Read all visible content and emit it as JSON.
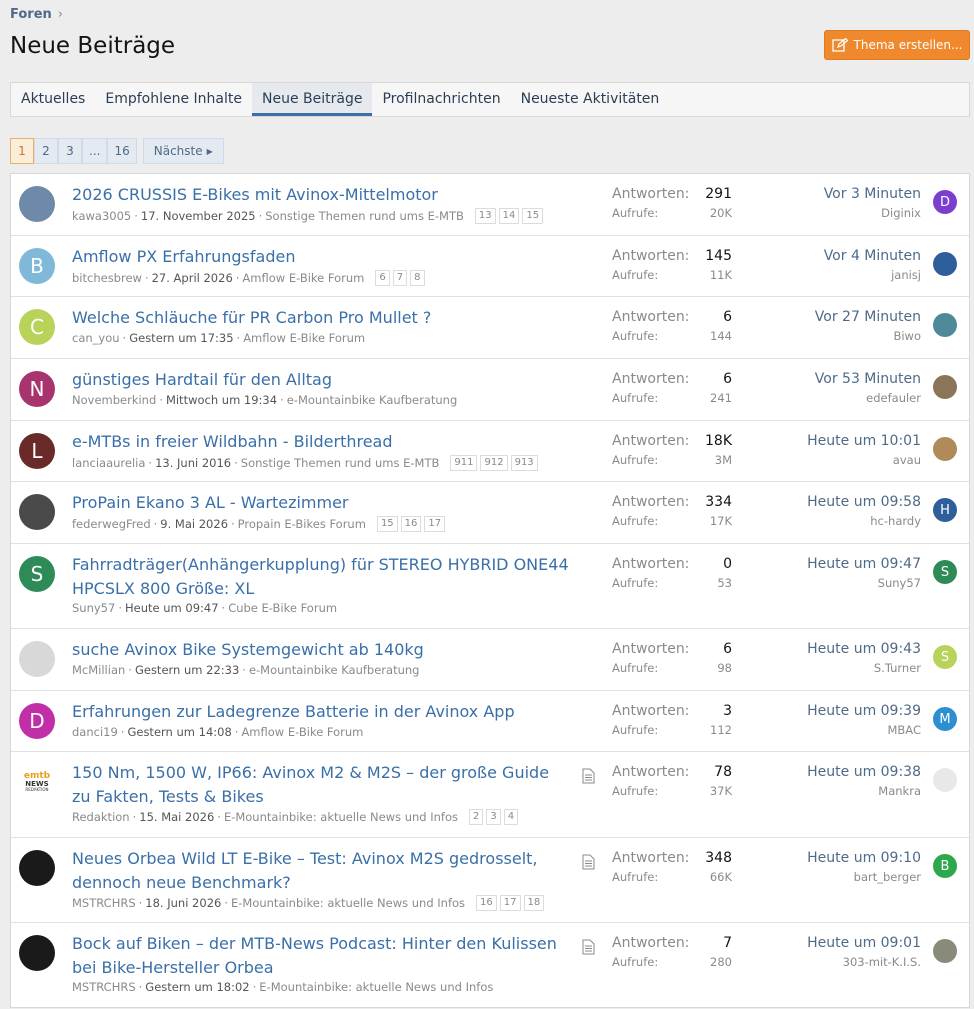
{
  "breadcrumb": {
    "label": "Foren"
  },
  "page_title": "Neue Beiträge",
  "create_button": "Thema erstellen...",
  "tabs": [
    "Aktuelles",
    "Empfohlene Inhalte",
    "Neue Beiträge",
    "Profilnachrichten",
    "Neueste Aktivitäten"
  ],
  "pagination": {
    "pages": [
      "1",
      "2",
      "3",
      "...",
      "16"
    ],
    "next": "Nächste"
  },
  "labels": {
    "replies": "Antworten:",
    "views": "Aufrufe:"
  },
  "threads": [
    {
      "title": "2026 CRUSSIS E-Bikes mit Avinox-Mittelmotor",
      "author": "kawa3005",
      "date": "17. November 2025",
      "forum": "Sonstige Themen rund ums E-MTB",
      "pages": [
        "13",
        "14",
        "15"
      ],
      "replies": "291",
      "views": "20K",
      "last_time": "Vor 3 Minuten",
      "last_user": "Diginix",
      "avatar": {
        "letter": "",
        "color": "#6e8aa8"
      },
      "last_avatar": {
        "letter": "D",
        "color": "#7b3fd0"
      }
    },
    {
      "title": "Amflow PX Erfahrungsfaden",
      "author": "bitchesbrew",
      "date": "27. April 2026",
      "forum": "Amflow E-Bike Forum",
      "pages": [
        "6",
        "7",
        "8"
      ],
      "replies": "145",
      "views": "11K",
      "last_time": "Vor 4 Minuten",
      "last_user": "janisj",
      "avatar": {
        "letter": "B",
        "color": "#7fb8d8"
      },
      "last_avatar": {
        "letter": "",
        "color": "#2f5f9a"
      }
    },
    {
      "title": "Welche Schläuche für PR Carbon Pro Mullet ?",
      "author": "can_you",
      "date": "Gestern um 17:35",
      "forum": "Amflow E-Bike Forum",
      "pages": [],
      "replies": "6",
      "views": "144",
      "last_time": "Vor 27 Minuten",
      "last_user": "Biwo",
      "avatar": {
        "letter": "C",
        "color": "#b9d35a"
      },
      "last_avatar": {
        "letter": "",
        "color": "#4e8a9a"
      }
    },
    {
      "title": "günstiges Hardtail für den Alltag",
      "author": "Novemberkind",
      "date": "Mittwoch um 19:34",
      "forum": "e-Mountainbike Kaufberatung",
      "pages": [],
      "replies": "6",
      "views": "241",
      "last_time": "Vor 53 Minuten",
      "last_user": "edefauler",
      "avatar": {
        "letter": "N",
        "color": "#a8346e"
      },
      "last_avatar": {
        "letter": "",
        "color": "#8a7558"
      }
    },
    {
      "title": "e-MTBs in freier Wildbahn - Bilderthread",
      "author": "lanciaaurelia",
      "date": "13. Juni 2016",
      "forum": "Sonstige Themen rund ums E-MTB",
      "pages": [
        "911",
        "912",
        "913"
      ],
      "replies": "18K",
      "views": "3M",
      "last_time": "Heute um 10:01",
      "last_user": "avau",
      "avatar": {
        "letter": "L",
        "color": "#6b2a2a"
      },
      "last_avatar": {
        "letter": "",
        "color": "#b08a5a"
      }
    },
    {
      "title": "ProPain Ekano 3 AL - Wartezimmer",
      "author": "federwegFred",
      "date": "9. Mai 2026",
      "forum": "Propain E-Bikes Forum",
      "pages": [
        "15",
        "16",
        "17"
      ],
      "replies": "334",
      "views": "17K",
      "last_time": "Heute um 09:58",
      "last_user": "hc-hardy",
      "avatar": {
        "letter": "",
        "color": "#4a4a4a"
      },
      "last_avatar": {
        "letter": "H",
        "color": "#2f5f9a"
      }
    },
    {
      "title": "Fahrradträger(Anhängerkupplung) für STEREO HYBRID ONE44 HPCSLX 800 Größe: XL",
      "author": "Suny57",
      "date": "Heute um 09:47",
      "forum": "Cube E-Bike Forum",
      "pages": [],
      "replies": "0",
      "views": "53",
      "last_time": "Heute um 09:47",
      "last_user": "Suny57",
      "avatar": {
        "letter": "S",
        "color": "#2e8b57"
      },
      "last_avatar": {
        "letter": "S",
        "color": "#2e8b57"
      }
    },
    {
      "title": "suche Avinox Bike Systemgewicht ab 140kg",
      "author": "McMillian",
      "date": "Gestern um 22:33",
      "forum": "e-Mountainbike Kaufberatung",
      "pages": [],
      "replies": "6",
      "views": "98",
      "last_time": "Heute um 09:43",
      "last_user": "S.Turner",
      "avatar": {
        "letter": "",
        "color": "#d8d8d8"
      },
      "last_avatar": {
        "letter": "S",
        "color": "#b9d35a"
      }
    },
    {
      "title": "Erfahrungen zur Ladegrenze Batterie in der Avinox App",
      "author": "danci19",
      "date": "Gestern um 14:08",
      "forum": "Amflow E-Bike Forum",
      "pages": [],
      "replies": "3",
      "views": "112",
      "last_time": "Heute um 09:39",
      "last_user": "MBAC",
      "avatar": {
        "letter": "D",
        "color": "#c02ea8"
      },
      "last_avatar": {
        "letter": "M",
        "color": "#2e8fd0"
      }
    },
    {
      "title": "150 Nm, 1500 W, IP66: Avinox M2 & M2S – der große Guide zu Fakten, Tests & Bikes",
      "author": "Redaktion",
      "date": "15. Mai 2026",
      "forum": "E-Mountainbike: aktuelle News und Infos",
      "pages": [
        "2",
        "3",
        "4"
      ],
      "replies": "78",
      "views": "37K",
      "last_time": "Heute um 09:38",
      "last_user": "Mankra",
      "avatar": {
        "letter": "",
        "color": "#ffffff"
      },
      "last_avatar": {
        "letter": "",
        "color": "#e8e8e8"
      },
      "logo_text": {
        "top": "emtb",
        "mid": "NEWS",
        "bottom": "REDAKTION"
      }
    },
    {
      "title": "Neues Orbea Wild LT E-Bike – Test: Avinox M2S gedrosselt, dennoch neue Benchmark?",
      "author": "MSTRCHRS",
      "date": "18. Juni 2026",
      "forum": "E-Mountainbike: aktuelle News und Infos",
      "pages": [
        "16",
        "17",
        "18"
      ],
      "replies": "348",
      "views": "66K",
      "last_time": "Heute um 09:10",
      "last_user": "bart_berger",
      "avatar": {
        "letter": "",
        "color": "#1a1a1a"
      },
      "last_avatar": {
        "letter": "B",
        "color": "#2ea84a"
      }
    },
    {
      "title": "Bock auf Biken – der MTB-News Podcast: Hinter den Kulissen bei Bike-Hersteller Orbea",
      "author": "MSTRCHRS",
      "date": "Gestern um 18:02",
      "forum": "E-Mountainbike: aktuelle News und Infos",
      "pages": [],
      "replies": "7",
      "views": "280",
      "last_time": "Heute um 09:01",
      "last_user": "303-mit-K.I.S.",
      "avatar": {
        "letter": "",
        "color": "#1a1a1a"
      },
      "last_avatar": {
        "letter": "",
        "color": "#8a8a7a"
      }
    }
  ]
}
